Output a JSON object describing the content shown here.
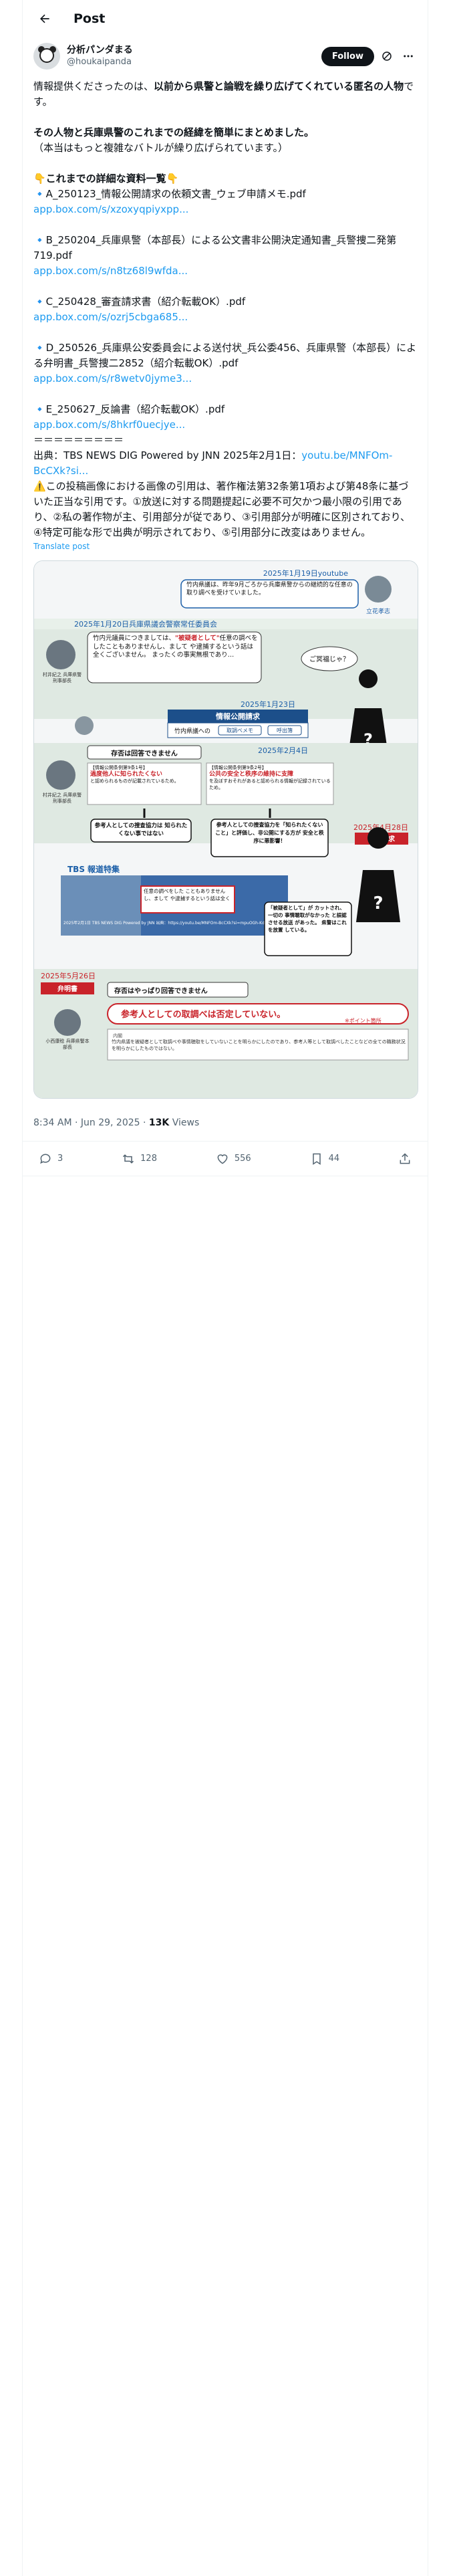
{
  "header": {
    "title": "Post"
  },
  "author": {
    "name": "分析パンダまる",
    "handle": "@houkaipanda",
    "follow_label": "Follow"
  },
  "post": {
    "l1a": "情報提供くださったのは、",
    "l1b": "以前から県警と論戦を繰り広げてくれている匿名の人物",
    "l1c": "です。",
    "l2": "その人物と兵庫県警のこれまでの経緯を簡単にまとめました。",
    "l3": "（本当はもっと複雑なバトルが繰り広げられています。）",
    "l4": "👇これまでの詳細な資料一覧👇",
    "docs": [
      {
        "title": "🔹A_250123_情報公開請求の依頼文書_ウェブ申請メモ.pdf",
        "link": "app.box.com/s/xzoxyqpiyxpp..."
      },
      {
        "title": "🔹B_250204_兵庫県警（本部長）による公文書非公開決定通知書_兵警捜二発第719.pdf",
        "link": "app.box.com/s/n8tz68l9wfda..."
      },
      {
        "title": "🔹C_250428_審査請求書（紹介転載OK）.pdf",
        "link": "app.box.com/s/ozrj5cbga685..."
      },
      {
        "title": "🔹D_250526_兵庫県公安委員会による送付状_兵公委456、兵庫県警（本部長）による弁明書_兵警捜二2852（紹介転載OK）.pdf",
        "link": "app.box.com/s/r8wetv0jyme3..."
      },
      {
        "title": "🔹E_250627_反論書（紹介転載OK）.pdf",
        "link": "app.box.com/s/8hkrf0uecjye..."
      }
    ],
    "divider": "＝＝＝＝＝＝＝＝＝",
    "source": "出典：TBS NEWS DIG Powered by JNN 2025年2月1日：",
    "source_link": "youtu.be/MNFOm-BcCXk?si...",
    "cite": "⚠️この投稿画像における画像の引用は、著作権法第32条第1項および第48条に基づいた正当な引用です。①放送に対する問題提起に必要不可欠かつ最小限の引用であり、②私の著作物が主、引用部分が従であり、③引用部分が明確に区別されており、④特定可能な形で出典が明示されており、⑤引用部分に改変はありません。"
  },
  "translate_label": "Translate post",
  "infographic": {
    "d1": "2025年1月19日youtube",
    "q1": "竹内県議は、昨年9月ごろから兵庫県警からの継続的な任意の取り調べを受けていました。",
    "n1": "立花孝志",
    "d2": "2025年1月20日兵庫県議会警察常任委員会",
    "q2a": "竹内元議員につきましては、",
    "q2b": "\"被疑者として\"",
    "q2c": "任意の調べをしたこともありませんし、まして や逮捕するという話は全くございません。 まったくの事実無根であり…",
    "n2": "村井紀之 兵庫県警刑事部長",
    "q3": "ご冥福じゃ？",
    "d3": "2025年1月23日",
    "h1": "情報公開請求",
    "r1": "竹内県議への",
    "r2": "取調べメモ",
    "r3": "呼出簿",
    "d4": "2025年2月4日",
    "b4": "存否は回答できません",
    "k1a": "【情報公開条例第9条1号】",
    "k1b": "過度他人に知られたくない",
    "k1c": "と認められるものが記載されているため。",
    "k2a": "【情報公開条例第9条2号】",
    "k2b": "公共の安全と秩序の維持に支障",
    "k2c": "を及ぼすおそれがあると認められる情報が記録されているため。",
    "n4": "村井紀之 兵庫県警刑事部長",
    "g1": "参考人としての捜査協力は 知られたくない事ではない",
    "g2": "参考人としての捜査協力を「知られたくないこと」と評価し、非公開にする方が 安全と秩序に悪影響！",
    "d5": "2025年4月28日",
    "t5": "審査請求",
    "tbs1": "TBS",
    "tbs2": "報道特集",
    "tv1": "任意の調べをした こともありませんし、まして や逮捕するという話は全く",
    "tvsrc": "2025年2月1日 TBS NEWS DIG Powered by JNN 出典：https://youtu.be/MNFOm-BcCXk?si=mpuOGh-KdOnIkl4h",
    "g3": "「被疑者として」が カットされ、一切の 事情聴取がなかった と誤認させる放送 があった。 県警はこれを放置 している。",
    "d6": "2025年5月26日",
    "t6": "弁明書",
    "b6": "存否はやっぱり回答できません",
    "q6a": "参考人としての取調べは否定していない。",
    "q6b": "※ポイント箇所",
    "sm": "内閣",
    "sm2": "竹内県議を被疑者として取調べや事情聴取をしていないことを明らかにしたのであり、参考人等として取調べしたことなどの全ての職務状況を明らかにしたものではない。",
    "n6": "小西康稔 兵庫県警本部長"
  },
  "meta": {
    "time": "8:34 AM · Jun 29, 2025 · ",
    "views_num": "13K",
    "views_label": " Views"
  },
  "actions": {
    "replies": "3",
    "reposts": "128",
    "likes": "556",
    "bookmarks": "44"
  }
}
